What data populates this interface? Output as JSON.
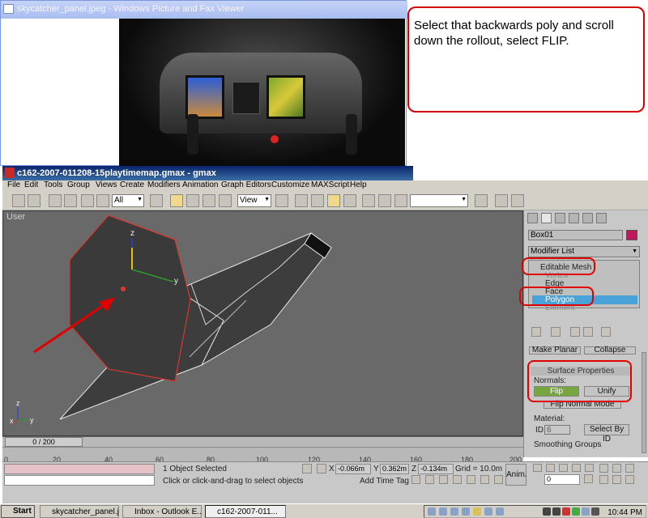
{
  "viewer": {
    "title": "skycatcher_panel.jpeg - Windows Picture and Fax Viewer"
  },
  "note": {
    "text": "Select that backwards poly and scroll down the rollout, select FLIP."
  },
  "gmax": {
    "title": "c162-2007-011208-15playtimemap.gmax - gmax",
    "menu": [
      "File",
      "Edit",
      "Tools",
      "Group",
      "Views",
      "Create",
      "Modifiers",
      "Animation",
      "Graph Editors",
      "Customize",
      "MAXScript",
      "Help"
    ],
    "toolbar": {
      "filter": "All",
      "ref_coord": "View"
    },
    "viewport": {
      "label": "User",
      "gizmo_z": "z",
      "gizmo_y": "y",
      "axis_z": "z",
      "axis_x": "x",
      "axis_y": "y"
    },
    "panel": {
      "object_name": "Box01",
      "object_color": "#c0185d",
      "modifier_list": "Modifier List",
      "stack": [
        "Editable Mesh",
        "Vertex",
        "Edge",
        "Face",
        "Polygon",
        "Element"
      ],
      "selected_stack_item": "Polygon",
      "make_planar": "Make Planar",
      "collapse": "Collapse",
      "surface_properties": "Surface Properties",
      "normals_label": "Normals:",
      "flip": "Flip",
      "unify": "Unify",
      "flip_normal_mode": "Flip Normal Mode",
      "material_label": "Material:",
      "id_label": "ID:",
      "id_value": "6",
      "select_by_id": "Select By ID",
      "smoothing_groups": "Smoothing Groups"
    },
    "timeline": {
      "frame": "0 / 200",
      "ticks": [
        "0",
        "20",
        "40",
        "60",
        "80",
        "100",
        "120",
        "140",
        "160",
        "180",
        "200"
      ]
    },
    "status": {
      "selection": "1 Object Selected",
      "prompt": "Click or click-and-drag to select objects",
      "x_label": "X",
      "x": "-0.066m",
      "y_label": "Y",
      "y": "0.362m",
      "z_label": "Z",
      "z": "-0.134m",
      "grid": "Grid = 10.0m",
      "add_time_tag": "Add Time Tag",
      "anim": "Anim.",
      "frame_field": "0"
    }
  },
  "taskbar": {
    "start": "Start",
    "tasks": [
      "skycatcher_panel.jpeg...",
      "Inbox - Outlook E...",
      "c162-2007-011..."
    ],
    "clock": "10:44 PM"
  },
  "colors": {
    "annotation_red": "#e00000",
    "selection_blue": "#4aa3d8",
    "flip_green": "#77a640",
    "poly_highlight": "#d8382e"
  }
}
